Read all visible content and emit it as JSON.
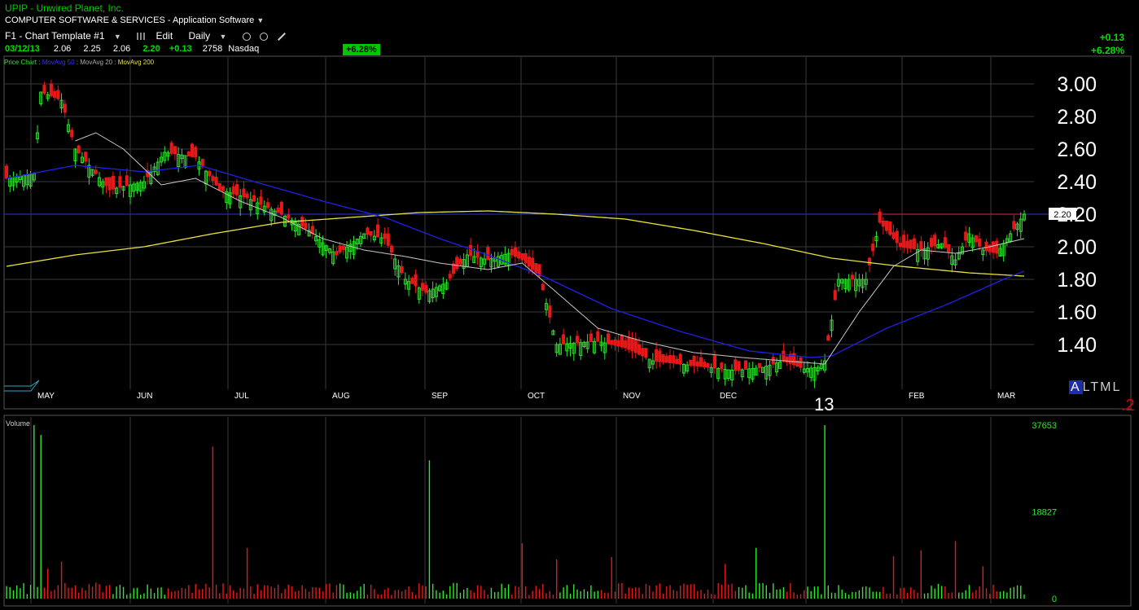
{
  "header": {
    "title": "UPIP - Unwired Planet, Inc.",
    "industry": "COMPUTER SOFTWARE & SERVICES - Application Software",
    "toolbar": {
      "template": "F1 - Chart Template #1",
      "edit": "Edit",
      "interval": "Daily"
    },
    "quote": {
      "date": "03/12/13",
      "open": "2.06",
      "high": "2.25",
      "low": "2.06",
      "last": "2.20",
      "change": "+0.13",
      "volume": "2758",
      "exchange": "Nasdaq",
      "pct": "+6.28%"
    },
    "right": {
      "change": "+0.13",
      "pct": "+6.28%"
    }
  },
  "legend": {
    "price": "Price Chart",
    "ma50": "MovAvg 50",
    "ma20": "MovAvg 20",
    "ma200": "MovAvg 200"
  },
  "footer": {
    "altml": [
      "A",
      "L",
      "T",
      "M",
      "L"
    ],
    "red_digit": ".2"
  },
  "colors": {
    "up": "#2ee82e",
    "down": "#e81818",
    "ma20": "#c8c8c8",
    "ma50": "#2020e8",
    "ma200": "#e8e040",
    "grid": "#3a3a3a",
    "level": "#1c2fa8"
  },
  "chart_data": [
    {
      "type": "candlestick",
      "title": "Price Chart",
      "ylim": [
        1.2,
        3.1
      ],
      "yticks": [
        "3.00",
        "2.80",
        "2.60",
        "2.40",
        "2.20",
        "2.00",
        "1.80",
        "1.60",
        "1.40"
      ],
      "ytick_values": [
        3.0,
        2.8,
        2.6,
        2.4,
        2.2,
        2.0,
        1.8,
        1.6,
        1.4
      ],
      "months": [
        "MAY",
        "JUN",
        "JUL",
        "AUG",
        "SEP",
        "OCT",
        "NOV",
        "DEC",
        "13",
        "FEB",
        "MAR"
      ],
      "current_price_label": "2.20",
      "current_price": 2.2,
      "key_points": [
        [
          0,
          2.42
        ],
        [
          8,
          2.45
        ],
        [
          10,
          2.95
        ],
        [
          16,
          2.9
        ],
        [
          20,
          2.6
        ],
        [
          30,
          2.35
        ],
        [
          40,
          2.4
        ],
        [
          46,
          2.58
        ],
        [
          55,
          2.55
        ],
        [
          62,
          2.35
        ],
        [
          70,
          2.3
        ],
        [
          80,
          2.2
        ],
        [
          88,
          2.1
        ],
        [
          96,
          1.95
        ],
        [
          104,
          2.08
        ],
        [
          110,
          2.05
        ],
        [
          116,
          1.8
        ],
        [
          122,
          1.72
        ],
        [
          128,
          1.78
        ],
        [
          134,
          1.95
        ],
        [
          140,
          1.92
        ],
        [
          146,
          1.96
        ],
        [
          150,
          1.92
        ],
        [
          155,
          1.82
        ],
        [
          160,
          1.4
        ],
        [
          172,
          1.42
        ],
        [
          180,
          1.38
        ],
        [
          188,
          1.3
        ],
        [
          196,
          1.28
        ],
        [
          204,
          1.26
        ],
        [
          212,
          1.24
        ],
        [
          220,
          1.26
        ],
        [
          226,
          1.3
        ],
        [
          232,
          1.25
        ],
        [
          236,
          1.26
        ],
        [
          238,
          1.3
        ],
        [
          242,
          1.8
        ],
        [
          250,
          1.8
        ],
        [
          254,
          2.15
        ],
        [
          260,
          2.0
        ],
        [
          266,
          1.98
        ],
        [
          272,
          2.02
        ],
        [
          276,
          1.92
        ],
        [
          280,
          2.08
        ],
        [
          284,
          1.98
        ],
        [
          288,
          1.96
        ],
        [
          292,
          2.08
        ],
        [
          296,
          2.2
        ]
      ],
      "ma20": [
        [
          20,
          2.65
        ],
        [
          26,
          2.7
        ],
        [
          34,
          2.6
        ],
        [
          45,
          2.38
        ],
        [
          55,
          2.42
        ],
        [
          68,
          2.28
        ],
        [
          80,
          2.18
        ],
        [
          92,
          2.05
        ],
        [
          104,
          1.98
        ],
        [
          116,
          1.94
        ],
        [
          126,
          1.9
        ],
        [
          140,
          1.86
        ],
        [
          150,
          1.9
        ],
        [
          160,
          1.72
        ],
        [
          172,
          1.5
        ],
        [
          185,
          1.42
        ],
        [
          200,
          1.35
        ],
        [
          214,
          1.32
        ],
        [
          226,
          1.3
        ],
        [
          238,
          1.28
        ],
        [
          248,
          1.6
        ],
        [
          258,
          1.88
        ],
        [
          266,
          1.98
        ],
        [
          276,
          1.96
        ],
        [
          286,
          2.0
        ],
        [
          296,
          2.05
        ]
      ],
      "ma50": [
        [
          0,
          2.42
        ],
        [
          20,
          2.5
        ],
        [
          40,
          2.46
        ],
        [
          56,
          2.5
        ],
        [
          72,
          2.4
        ],
        [
          92,
          2.28
        ],
        [
          110,
          2.18
        ],
        [
          126,
          2.05
        ],
        [
          140,
          1.95
        ],
        [
          156,
          1.82
        ],
        [
          176,
          1.62
        ],
        [
          196,
          1.48
        ],
        [
          216,
          1.36
        ],
        [
          234,
          1.32
        ],
        [
          240,
          1.33
        ],
        [
          256,
          1.5
        ],
        [
          274,
          1.65
        ],
        [
          290,
          1.8
        ],
        [
          296,
          1.85
        ]
      ],
      "ma200": [
        [
          0,
          1.88
        ],
        [
          20,
          1.95
        ],
        [
          40,
          2.0
        ],
        [
          60,
          2.08
        ],
        [
          80,
          2.15
        ],
        [
          100,
          2.18
        ],
        [
          120,
          2.21
        ],
        [
          140,
          2.22
        ],
        [
          160,
          2.2
        ],
        [
          180,
          2.17
        ],
        [
          200,
          2.1
        ],
        [
          220,
          2.02
        ],
        [
          240,
          1.93
        ],
        [
          260,
          1.88
        ],
        [
          280,
          1.84
        ],
        [
          296,
          1.82
        ]
      ]
    },
    {
      "type": "bar",
      "title": "Volume",
      "yticks": [
        "37653",
        "18827",
        "0"
      ],
      "ytick_values": [
        37653,
        18827,
        0
      ],
      "ylim": [
        0,
        37653
      ],
      "spikes": [
        [
          8,
          37653
        ],
        [
          10,
          35500
        ],
        [
          12,
          6500
        ],
        [
          16,
          8000
        ],
        [
          26,
          3500
        ],
        [
          60,
          33000
        ],
        [
          70,
          11000
        ],
        [
          123,
          30000
        ],
        [
          150,
          12000
        ],
        [
          160,
          8500
        ],
        [
          176,
          9000
        ],
        [
          209,
          7500
        ],
        [
          218,
          11000
        ],
        [
          238,
          37653
        ],
        [
          258,
          9200
        ],
        [
          266,
          10500
        ],
        [
          276,
          12500
        ],
        [
          284,
          7000
        ]
      ]
    }
  ]
}
